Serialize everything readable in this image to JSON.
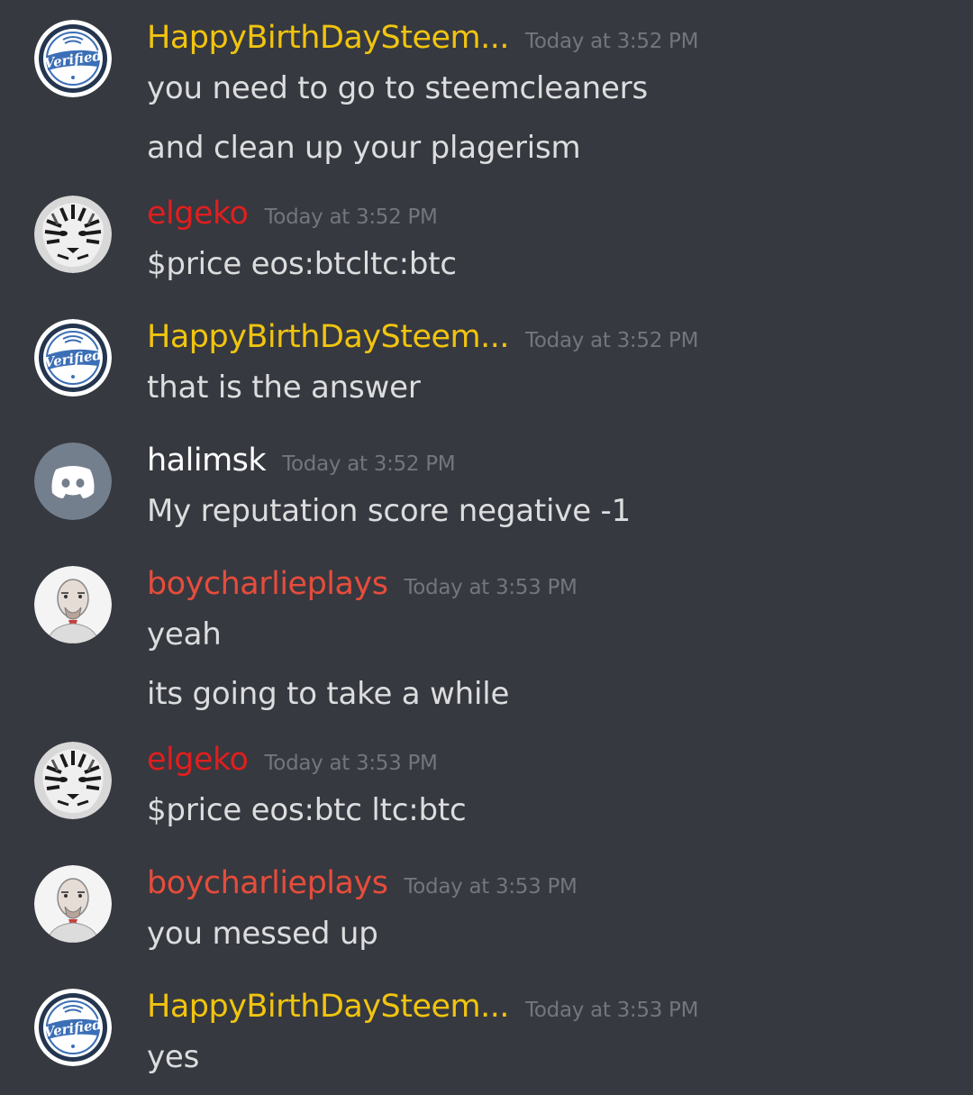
{
  "colors": {
    "background": "#36393f",
    "username_yellow": "#f1c40f",
    "username_red_dark": "#e01e1e",
    "username_red": "#e74c3c",
    "username_white": "#ffffff",
    "timestamp": "#72767d",
    "text": "#dcddde"
  },
  "messages": [
    {
      "username": "HappyBirthDaySteem...",
      "timestamp": "Today at 3:52 PM",
      "avatar": "verified-badge-icon",
      "lines": [
        "you need to go to steemcleaners",
        "and clean up your plagerism"
      ]
    },
    {
      "username": "elgeko",
      "timestamp": "Today at 3:52 PM",
      "avatar": "tiger-avatar-icon",
      "lines": [
        "$price eos:btcltc:btc"
      ]
    },
    {
      "username": "HappyBirthDaySteem...",
      "timestamp": "Today at 3:52 PM",
      "avatar": "verified-badge-icon",
      "lines": [
        "that is the answer"
      ]
    },
    {
      "username": "halimsk",
      "timestamp": "Today at 3:52 PM",
      "avatar": "discord-default-avatar-icon",
      "lines": [
        "My reputation score negative -1"
      ]
    },
    {
      "username": "boycharlieplays",
      "timestamp": "Today at 3:53 PM",
      "avatar": "portrait-avatar-icon",
      "lines": [
        "yeah",
        "its going to take a while"
      ]
    },
    {
      "username": "elgeko",
      "timestamp": "Today at 3:53 PM",
      "avatar": "tiger-avatar-icon",
      "lines": [
        "$price eos:btc ltc:btc"
      ]
    },
    {
      "username": "boycharlieplays",
      "timestamp": "Today at 3:53 PM",
      "avatar": "portrait-avatar-icon",
      "lines": [
        "you messed up"
      ]
    },
    {
      "username": "HappyBirthDaySteem...",
      "timestamp": "Today at 3:53 PM",
      "avatar": "verified-badge-icon",
      "lines": [
        "yes"
      ]
    }
  ]
}
